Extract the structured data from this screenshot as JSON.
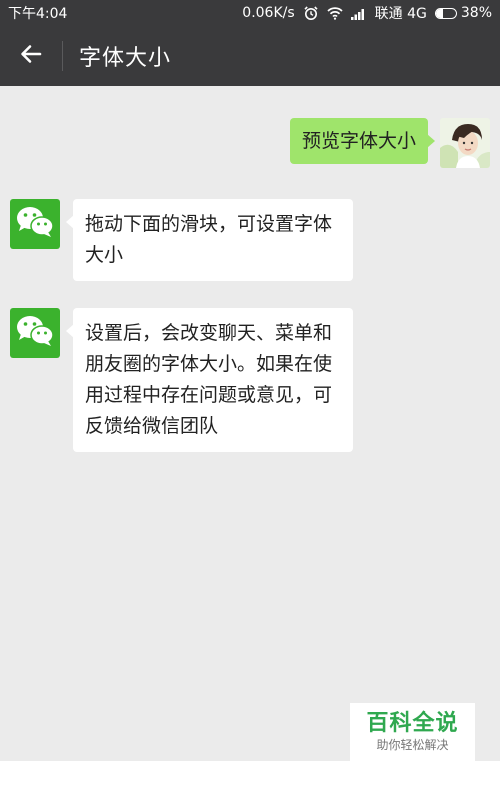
{
  "status_bar": {
    "time": "下午4:04",
    "network_speed": "0.06K/s",
    "carrier": "联通 4G",
    "battery_percent": "38%",
    "battery_level": 0.38,
    "icons": [
      "alarm-icon",
      "wifi-icon",
      "signal-icon",
      "battery-icon"
    ]
  },
  "header": {
    "back_icon": "arrow-left-icon",
    "title": "字体大小"
  },
  "messages": [
    {
      "side": "right",
      "sender": "user",
      "text": "预览字体大小"
    },
    {
      "side": "left",
      "sender": "wechat",
      "text": "拖动下面的滑块，可设置字体大小"
    },
    {
      "side": "left",
      "sender": "wechat",
      "text": "设置后，会改变聊天、菜单和朋友圈的字体大小。如果在使用过程中存在问题或意见，可反馈给微信团队"
    }
  ],
  "watermark": {
    "title": "百科全说",
    "subtitle": "助你轻松解决"
  },
  "colors": {
    "header_bg": "#3a3a3c",
    "chat_bg": "#ebebeb",
    "bubble_green": "#9fe46b",
    "wechat_green": "#3bb22d",
    "watermark_green": "#2fa84f"
  }
}
